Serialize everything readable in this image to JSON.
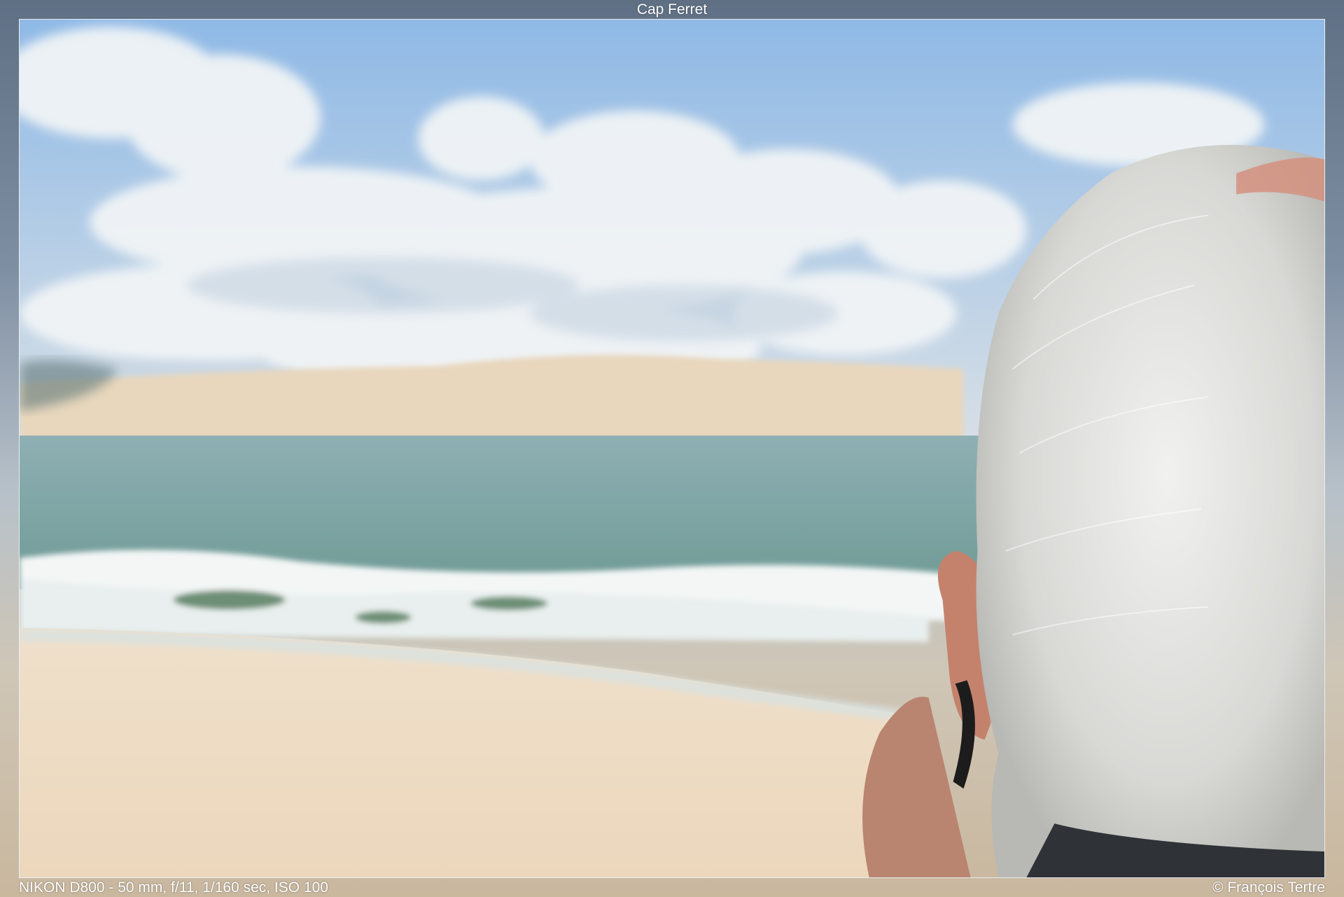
{
  "photo": {
    "title": "Cap Ferret",
    "exif": "NIKON D800 - 50 mm, f/11, 1/160 sec, ISO 100",
    "copyright": "© François Tertre",
    "scene_icon": "seaside-dune-photo-icon"
  },
  "palette": {
    "sky": "#a9c7e3",
    "cloud": "#eef2f5",
    "dune": "#e7d6bd",
    "sea": "#7fa6a3",
    "foam": "#f2f5f4",
    "sand": "#efdcc3",
    "hair": "#e5e5e3",
    "skin": "#c98e79"
  }
}
